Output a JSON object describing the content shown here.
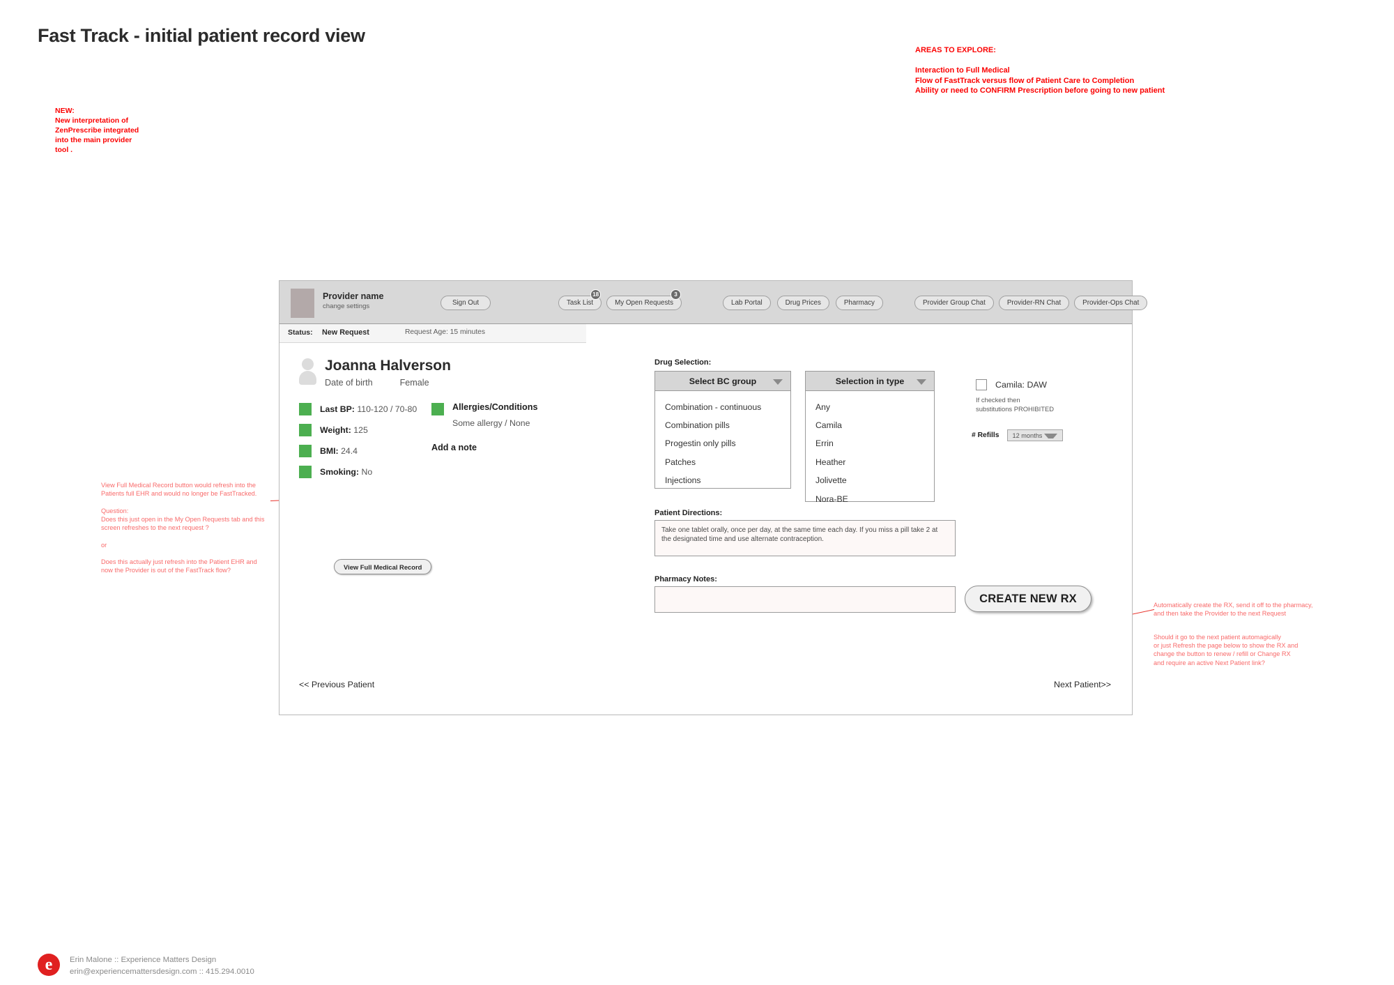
{
  "page": {
    "title": "Fast Track - initial patient record view"
  },
  "annotations": {
    "areas_title": "AREAS TO EXPLORE:",
    "areas_body": "Interaction to Full Medical\nFlow of FastTrack versus flow of Patient Care to Completion\nAbility or need to CONFIRM Prescription before going to new patient",
    "new_note": "NEW:\nNew interpretation of\nZenPrescribe integrated\ninto the main provider\ntool .",
    "record_note": "View Full Medical Record button would refresh into the\nPatients full EHR and would no longer be FastTracked.\n\nQuestion:\nDoes this just open in the My Open Requests tab and this\nscreen refreshes to the next request ?\n\nor\n\nDoes this actually just refresh into the Patient EHR and\nnow the Provider is out of the FastTrack flow?",
    "rx_note_1": "Automatically create the RX, send it off to the pharmacy,\nand then take the Provider to the next Request",
    "rx_note_2": "Should it go to the next patient automagically\nor just Refresh the page below to show the RX and\nchange the button to renew / refill or Change RX\nand require an active Next Patient link?"
  },
  "navbar": {
    "provider_name": "Provider name",
    "change_settings": "change settings",
    "sign_out": "Sign Out",
    "task_list": "Task List",
    "task_list_badge": "18",
    "my_open_requests": "My Open Requests",
    "my_open_requests_badge": "3",
    "lab_portal": "Lab Portal",
    "drug_prices": "Drug Prices",
    "pharmacy": "Pharmacy",
    "provider_group_chat": "Provider Group Chat",
    "provider_rn_chat": "Provider-RN Chat",
    "provider_ops_chat": "Provider-Ops Chat"
  },
  "statusbar": {
    "label": "Status:",
    "value": "New Request",
    "age": "Request Age: 15 minutes"
  },
  "patient": {
    "name": "Joanna Halverson",
    "dob_label": "Date of birth",
    "sex": "Female",
    "vitals": [
      {
        "label": "Last BP:",
        "value": "110-120 / 70-80",
        "color": "#4caf50"
      },
      {
        "label": "Weight:",
        "value": "125",
        "color": "#4caf50"
      },
      {
        "label": "BMI:",
        "value": "24.4",
        "color": "#4caf50"
      },
      {
        "label": "Smoking:",
        "value": "No",
        "color": "#4caf50"
      }
    ],
    "conditions_title": "Allergies/Conditions",
    "conditions_value": "Some allergy / None",
    "add_note": "Add a note",
    "view_record_button": "View Full Medical Record"
  },
  "drug": {
    "section_label": "Drug Selection:",
    "group_header": "Select BC group",
    "group_options": [
      "Combination - continuous",
      "Combination pills",
      "Progestin only pills",
      "Patches",
      "Injections"
    ],
    "type_header": "Selection in type",
    "type_options": [
      "Any",
      "Camila",
      "Errin",
      "Heather",
      "Jolivette",
      "Nora-BE"
    ],
    "daw_label": "Camila: DAW",
    "daw_note": "If checked then\nsubstitutions PROHIBITED",
    "refills_label": "# Refills",
    "refills_value": "12 months",
    "directions_label": "Patient Directions:",
    "directions_value": "Take one tablet orally, once per day, at the same time each day. If you miss a pill take 2 at the designated time and use alternate contraception.",
    "pharmacy_notes_label": "Pharmacy Notes:",
    "pharmacy_notes_value": "",
    "create_rx_button": "CREATE NEW RX"
  },
  "pager": {
    "previous": "<< Previous Patient",
    "next": "Next Patient>>"
  },
  "footer": {
    "logo_letter": "e",
    "line1": "Erin Malone :: Experience Matters Design",
    "line2": "erin@experiencemattersdesign.com :: 415.294.0010"
  },
  "colors": {
    "accent_green": "#4caf50",
    "annotation_red": "#fb0303",
    "brand_red": "#e02020"
  }
}
